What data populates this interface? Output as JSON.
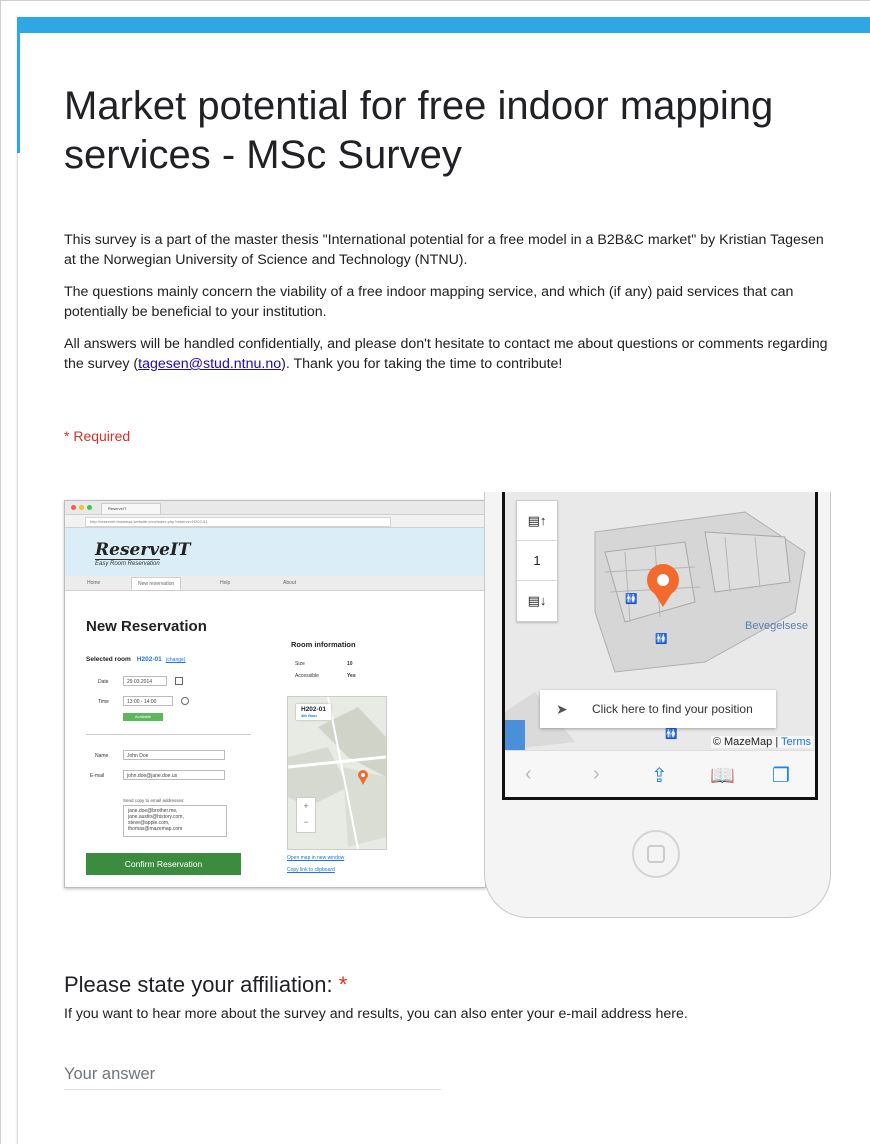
{
  "form": {
    "title": "Market potential for free indoor mapping services - MSc Survey",
    "description": {
      "p1": "This survey is a part of the master thesis \"International potential for a free model in a B2B&C market\" by Kristian Tagesen at the Norwegian University of Science and Technology (NTNU).",
      "p2": "The questions mainly concern the viability of a free indoor mapping service, and which (if any) paid services that can potentially be beneficial to your institution.",
      "p3_before": "All answers will be handled confidentially, and please don't hesitate to contact me about questions or comments regarding the survey (",
      "p3_email": "tagesen@stud.ntnu.no",
      "p3_after": "). Thank you for taking the time to contribute!"
    },
    "required_note": "* Required",
    "accent_color": "#2ea8e5"
  },
  "illustration": {
    "browser": {
      "tab": "ReserveIT",
      "url": "http://reserveit.business-website.com/index.php?reserve=H202-01",
      "logo": "ReserveIT",
      "tagline": "Easy Room Reservation",
      "nav": [
        "Home",
        "New reservation",
        "Help",
        "About"
      ],
      "heading": "New Reservation",
      "selected_room_label": "Selected room",
      "selected_room": "H202-01",
      "change": "(change)",
      "date_label": "Date",
      "date_value": "29.03.2014",
      "time_label": "Time",
      "time_value": "13:00 - 14:00",
      "available": "Available",
      "name_label": "Name",
      "name_value": "John Doe",
      "email_label": "E-mail",
      "email_value": "john.doe@jane.doe.us",
      "copy_label": "Send copy to email addresses:",
      "copy_emails": "jane.doe@brother.me, jane.austin@history.com, steve@apple.com, thomas@mazemap.com",
      "confirm": "Confirm Reservation",
      "room_info_title": "Room information",
      "size_label": "Size",
      "size_value": "10",
      "accessible_label": "Accessible",
      "accessible_value": "Yes",
      "map_room": "H202-01",
      "map_floor": "4th floor",
      "open_map": "Open map in new window",
      "copy_link": "Copy link to clipboard"
    },
    "phone": {
      "floor_level": "1",
      "find_position": "Click here to find your position",
      "place_label": "Bevegelsese",
      "attribution": "© MazeMap | ",
      "terms": "Terms"
    }
  },
  "question": {
    "title": "Please state your affiliation:",
    "required_star": "*",
    "help": "If you want to hear more about the survey and results, you can also enter your e-mail address here.",
    "placeholder": "Your answer",
    "value": ""
  }
}
